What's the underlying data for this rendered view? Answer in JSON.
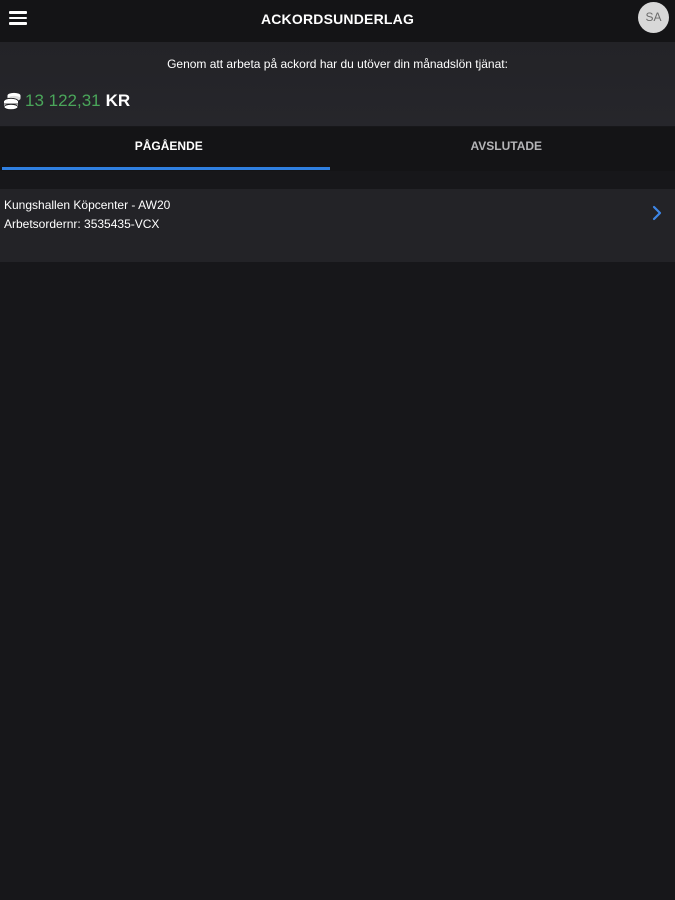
{
  "header": {
    "title": "ACKORDSUNDERLAG",
    "avatar_initials": "SA",
    "menu_icon": "hamburger-menu-icon"
  },
  "summary": {
    "text": "Genom att arbeta på ackord har du utöver din månadslön tjänat:",
    "amount": "13 122,31",
    "currency": "KR",
    "amount_color": "#4aa65a",
    "icon": "coins-icon"
  },
  "tabs": [
    {
      "label": "PÅGÅENDE",
      "active": true
    },
    {
      "label": "AVSLUTADE",
      "active": false
    }
  ],
  "accent_color": "#2f7fe0",
  "list": {
    "items": [
      {
        "title": "Kungshallen Köpcenter - AW20",
        "subtitle": "Arbetsordernr: 3535435-VCX",
        "icon": "chevron-right-icon"
      }
    ]
  }
}
